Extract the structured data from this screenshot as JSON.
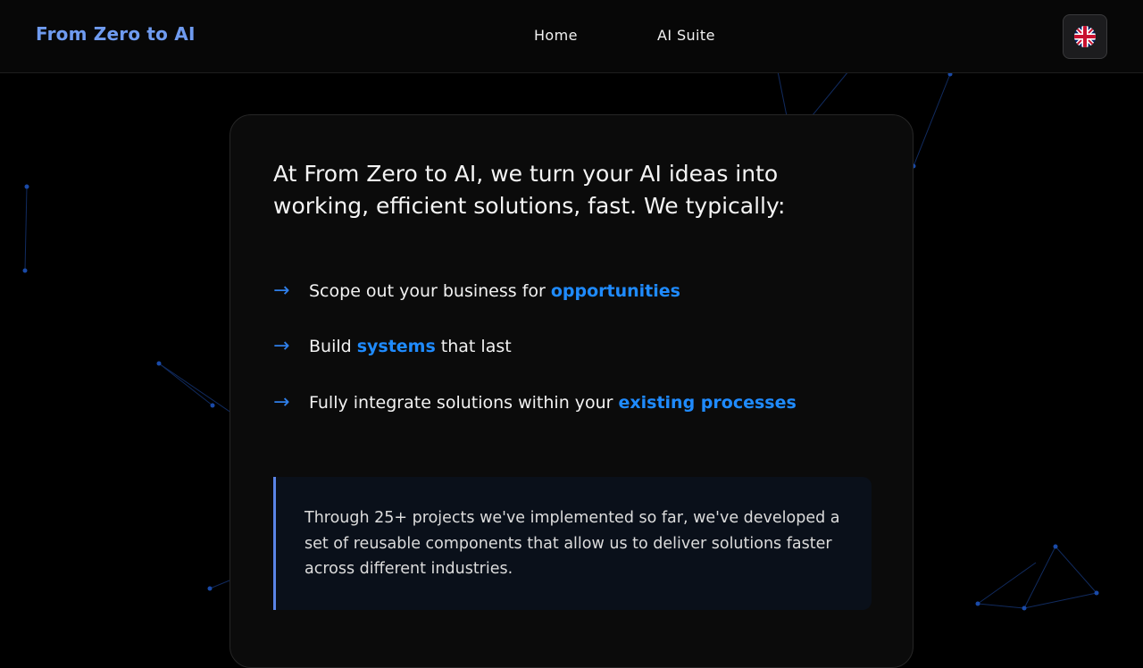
{
  "navbar": {
    "brand": "From Zero to AI",
    "links": [
      {
        "label": "Home"
      },
      {
        "label": "AI Suite"
      }
    ],
    "language_icon": "uk-flag-icon"
  },
  "content": {
    "intro": "At From Zero to AI, we turn your AI ideas into working, efficient solutions, fast. We typically:",
    "points": [
      {
        "text_before": "Scope out your business for",
        "highlight": "opportunities",
        "text_after": ""
      },
      {
        "text_before": "Build",
        "highlight": "systems",
        "text_after": "that last"
      },
      {
        "text_before": "Fully integrate solutions within your",
        "highlight": "existing processes",
        "text_after": ""
      }
    ],
    "arrow_glyph": "→",
    "quote": "Through 25+ projects we've implemented so far, we've developed a set of reusable components that allow us to deliver solutions faster across different industries."
  },
  "colors": {
    "brand": "#6f9bf0",
    "highlight": "#1f8bff",
    "quote_border": "#5a84e6"
  }
}
